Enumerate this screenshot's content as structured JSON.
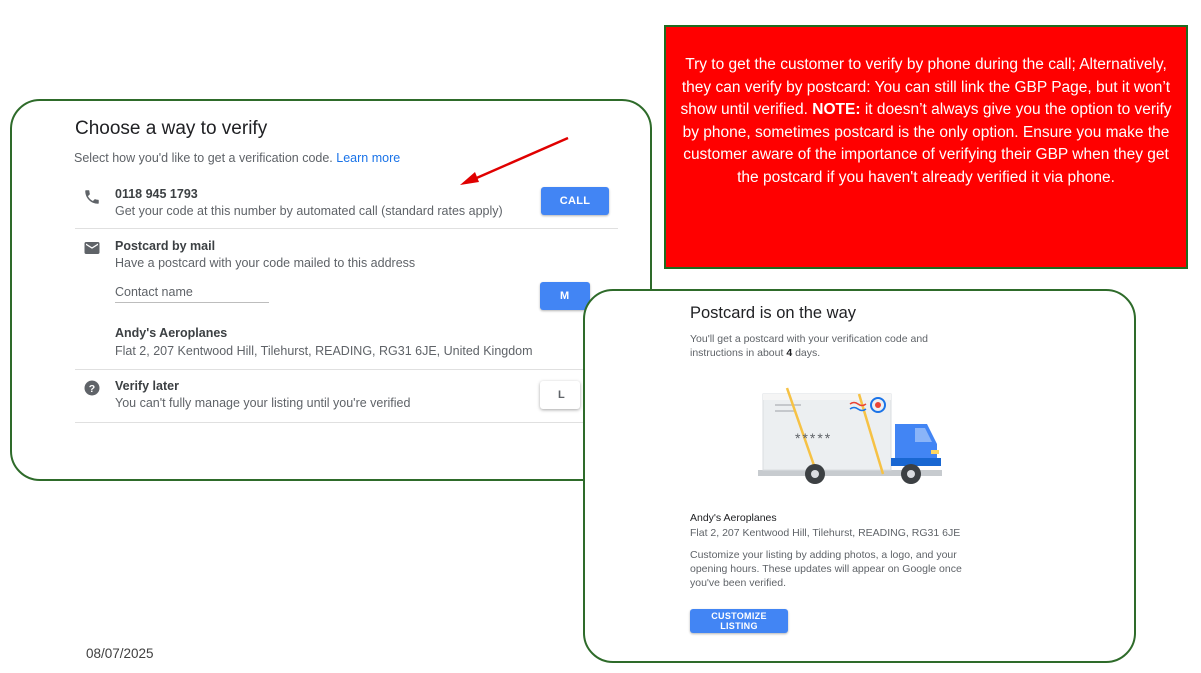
{
  "verify_panel": {
    "title": "Choose a way to verify",
    "subtitle": "Select how you'd like to get a verification code.",
    "learn_more": "Learn more",
    "phone": {
      "number": "0118 945 1793",
      "desc": "Get your code at this number by automated call (standard rates apply)",
      "button": "CALL",
      "icon": "phone-icon"
    },
    "postcard": {
      "title": "Postcard by mail",
      "desc": "Have a postcard with your code mailed to this address",
      "contact_placeholder": "Contact name",
      "button": "M",
      "business_name": "Andy's Aeroplanes",
      "address": "Flat 2, 207 Kentwood Hill, Tilehurst, READING, RG31 6JE, United Kingdom",
      "icon": "mail-icon"
    },
    "later": {
      "title": "Verify later",
      "desc": "You can't fully manage your listing until you're verified",
      "button": "L",
      "icon": "help-icon"
    }
  },
  "note": {
    "text_before": "Try to get the customer to verify by phone during the call; Alternatively, they can verify by postcard: You can still link the GBP Page, but it won’t show until verified.",
    "note_label": "NOTE:",
    "text_after": "it doesn’t always give you the option to verify by phone, sometimes postcard is the only option. Ensure you make the customer aware of the importance of verifying their GBP when they get the postcard if you haven't already verified it via phone."
  },
  "postcard_panel": {
    "title": "Postcard is on the way",
    "intro_before": "You'll get a postcard with your verification code and instructions in about",
    "days": "4",
    "intro_after": "days.",
    "stars": "*****",
    "business_name": "Andy's Aeroplanes",
    "address": "Flat 2, 207 Kentwood Hill, Tilehurst, READING, RG31 6JE",
    "customize_text": "Customize your listing by adding photos, a logo, and your opening hours. These updates will appear on Google once you've been verified.",
    "button": "CUSTOMIZE LISTING"
  },
  "footer": {
    "date": "08/07/2025"
  },
  "colors": {
    "note_bg": "#ff0000",
    "panel_border": "#2e6b2a",
    "button_blue": "#4285f4",
    "link_blue": "#1a73e8",
    "arrow_red": "#e00000"
  }
}
